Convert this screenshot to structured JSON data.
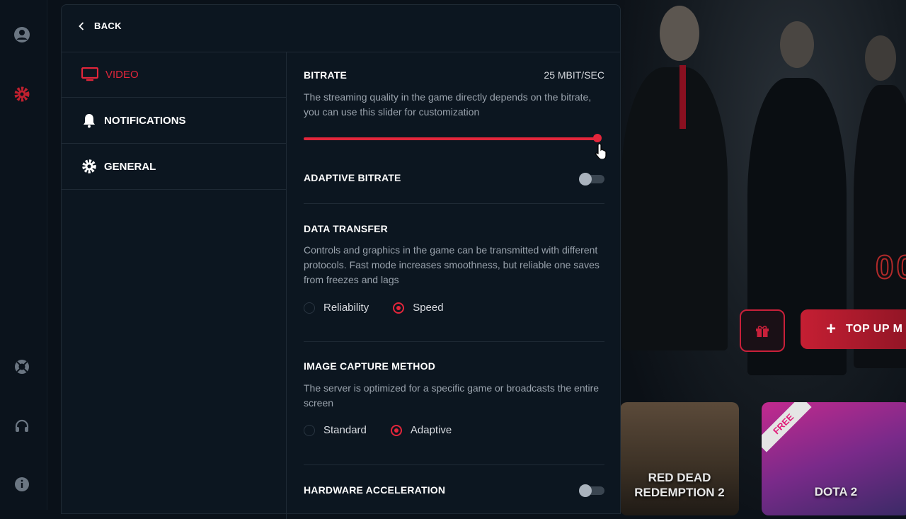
{
  "rail": {
    "icons": [
      "user-icon",
      "gear-icon",
      "lifebuoy-icon",
      "headset-icon",
      "info-icon"
    ]
  },
  "header": {
    "back_label": "BACK"
  },
  "sidebar": {
    "items": [
      {
        "label": "VIDEO",
        "icon": "monitor-icon",
        "active": true
      },
      {
        "label": "NOTIFICATIONS",
        "icon": "bell-icon",
        "active": false
      },
      {
        "label": "GENERAL",
        "icon": "gear-icon",
        "active": false
      }
    ]
  },
  "video": {
    "bitrate": {
      "title": "BITRATE",
      "value": "25 MBIT/SEC",
      "description": "The streaming quality in the game directly depends on the bitrate, you can use this slider for customization",
      "slider_fraction": 1.0
    },
    "adaptive_bitrate": {
      "title": "ADAPTIVE BITRATE",
      "enabled": false
    },
    "data_transfer": {
      "title": "DATA TRANSFER",
      "description": "Controls and graphics in the game can be transmitted with different protocols. Fast mode increases smoothness, but reliable one saves from freezes and lags",
      "options": [
        "Reliability",
        "Speed"
      ],
      "selected": "Speed"
    },
    "image_capture": {
      "title": "IMAGE CAPTURE METHOD",
      "description": "The server is optimized for a specific game or broadcasts the entire screen",
      "options": [
        "Standard",
        "Adaptive"
      ],
      "selected": "Adaptive"
    },
    "hardware_acceleration": {
      "title": "HARDWARE ACCELERATION",
      "enabled": false
    }
  },
  "background": {
    "topup_label": "TOP UP M",
    "games": [
      {
        "title": "RED DEAD REDEMPTION 2"
      },
      {
        "title": "DOTA 2",
        "badge": "FREE"
      }
    ]
  },
  "colors": {
    "accent": "#e3263b",
    "panel": "#0c1620",
    "page": "#0a1119"
  }
}
